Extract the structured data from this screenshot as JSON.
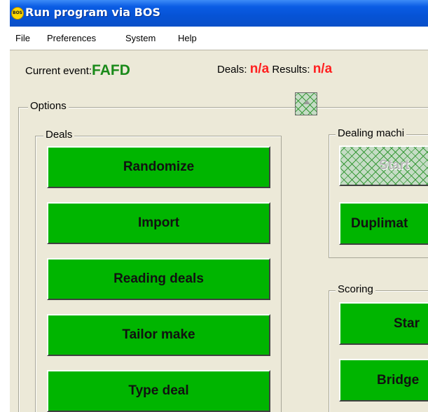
{
  "window": {
    "title": "Run program via BOS",
    "icon_text": "BOS"
  },
  "menu": [
    "File",
    "Preferences",
    "System",
    "Help"
  ],
  "status": {
    "current_event_label": "Current event:",
    "current_event_value": "FAFD",
    "deals_label": "Deals:",
    "deals_value": "n/a",
    "results_label": "Results:",
    "results_value": "n/a"
  },
  "options": {
    "label": "Options",
    "deals_group": {
      "label": "Deals",
      "buttons": [
        "Randomize",
        "Import",
        "Reading deals",
        "Tailor make",
        "Type deal"
      ]
    },
    "dealing_machine_group": {
      "label": "Dealing machi",
      "start_label": "Start",
      "duplimate_label": "Duplimat"
    },
    "scoring_group": {
      "label": "Scoring",
      "start_label": "Star",
      "bridgemate_label": "Bridge"
    }
  },
  "colors": {
    "button_green": "#00b500",
    "event_green": "#1a8a1a",
    "alert_red": "#ff2020",
    "title_blue": "#0a5ce4"
  }
}
